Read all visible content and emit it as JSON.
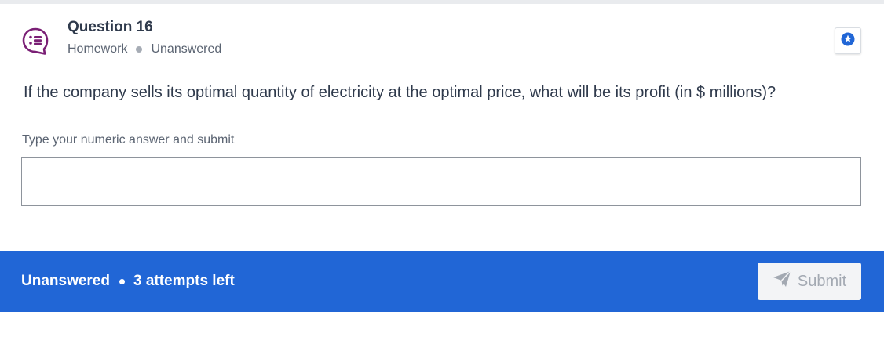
{
  "question": {
    "title": "Question 16",
    "category": "Homework",
    "state": "Unanswered",
    "prompt": "If the company sells its optimal quantity of electricity at the optimal price, what will be its profit (in $ millions)?"
  },
  "answer": {
    "label": "Type your numeric answer and submit",
    "value": "",
    "placeholder": ""
  },
  "footer": {
    "status": "Unanswered",
    "attempts": "3 attempts left",
    "submit_label": "Submit"
  },
  "icons": {
    "question": "question-list-chat-icon",
    "bookmark": "star-bookmark-icon",
    "submit": "paper-plane-icon"
  },
  "colors": {
    "accent_purple": "#7a1f75",
    "footer_blue": "#2166d6",
    "text_dark": "#2f3a4c",
    "text_muted": "#5b6472"
  }
}
